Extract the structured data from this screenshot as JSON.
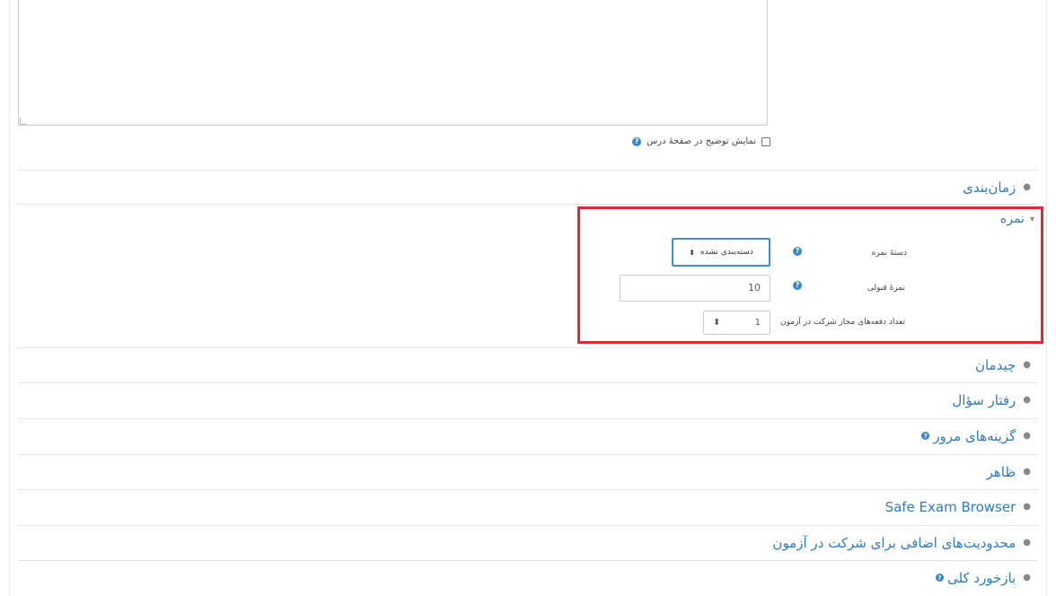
{
  "general": {
    "show_description_label": "نمایش توضیح در صفحهٔ درس",
    "help_icon": "question-circle-icon"
  },
  "sections": {
    "timing": "زمان‌بندی",
    "grade": "نمره",
    "layout": "چیدمان",
    "question_behaviour": "رفتار سؤال",
    "review_options": "گزینه‌های مرور",
    "appearance": "ظاهر",
    "seb": "Safe Exam Browser",
    "extra_restrictions": "محدودیت‌های اضافی برای شرکت در آزمون",
    "overall_feedback": "بازخورد کلی"
  },
  "grade": {
    "category_label": "دستهٔ نمره",
    "category_value": "دسته‌بندی نشده",
    "pass_label": "نمرهٔ قبولی",
    "pass_value": "10",
    "attempts_label": "تعداد دفعه‌های مجاز شرکت در آزمون",
    "attempts_value": "1"
  },
  "icons": {
    "collapsed": "▸",
    "expanded": "▾",
    "select_caret": "⬍"
  },
  "colors": {
    "link": "#2f7bbf",
    "highlight_border": "#e52630",
    "focus_border": "#3c8dd8",
    "help": "#3a87c8"
  }
}
